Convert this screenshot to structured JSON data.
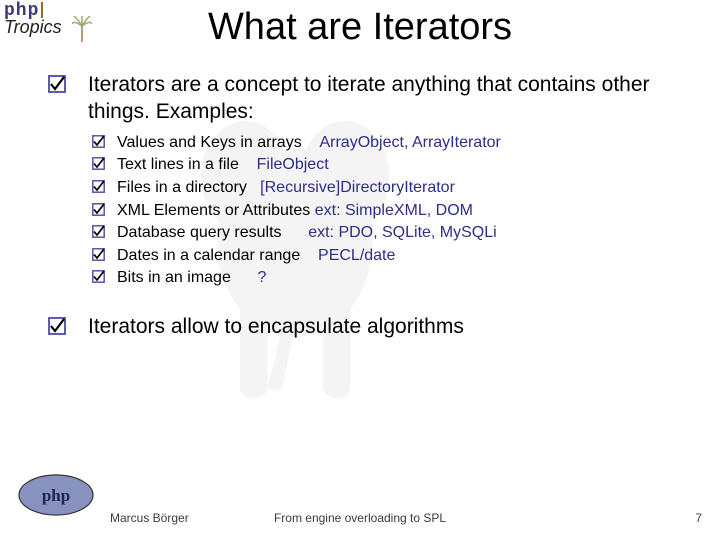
{
  "logo": {
    "top_line": "php",
    "bottom_line": "Tropics"
  },
  "title": "What are Iterators",
  "intro": {
    "text": "Iterators are a concept to iterate anything that contains other things. Examples:"
  },
  "subitems": [
    {
      "label": "Values and Keys in arrays",
      "pad": 4,
      "extra": "ArrayObject, ArrayIterator"
    },
    {
      "label": "Text lines in a file",
      "pad": 4,
      "extra": "FileObject"
    },
    {
      "label": "Files in a directory",
      "pad": 3,
      "extra": "[Recursive]DirectoryIterator"
    },
    {
      "label": "XML Elements or Attributes",
      "pad": 1,
      "extra": "ext: SimpleXML, DOM"
    },
    {
      "label": "Database query results",
      "pad": 6,
      "extra": "ext: PDO, SQLite, MySQLi"
    },
    {
      "label": "Dates in a calendar range",
      "pad": 4,
      "extra": "PECL/date"
    },
    {
      "label": "Bits in an image",
      "pad": 6,
      "extra": "?"
    }
  ],
  "second": {
    "text": "Iterators allow to encapsulate algorithms"
  },
  "footer": {
    "author": "Marcus Börger",
    "center": "From engine overloading to SPL",
    "page": "7"
  },
  "colors": {
    "extra_text": "#2d2d8a",
    "checkbox_border": "#4a4aa0",
    "checkbox_mark": "#000000"
  }
}
